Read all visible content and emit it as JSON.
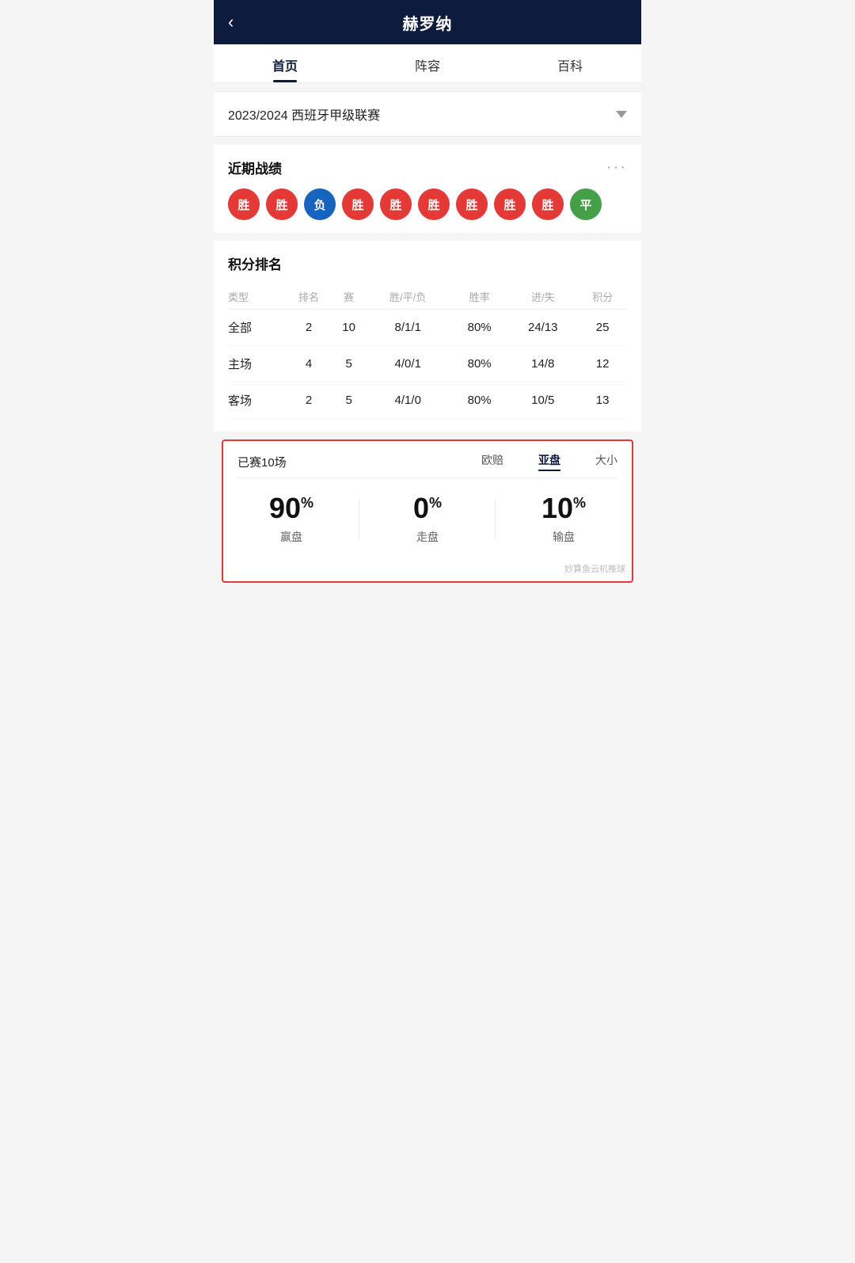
{
  "header": {
    "title": "赫罗纳",
    "back_icon": "‹"
  },
  "tabs": [
    {
      "label": "首页",
      "active": true
    },
    {
      "label": "阵容",
      "active": false
    },
    {
      "label": "百科",
      "active": false
    }
  ],
  "season": {
    "label": "2023/2024 西班牙甲级联赛"
  },
  "recent_results": {
    "title": "近期战绩",
    "more": "···",
    "results": [
      {
        "text": "胜",
        "type": "win"
      },
      {
        "text": "胜",
        "type": "win"
      },
      {
        "text": "负",
        "type": "loss"
      },
      {
        "text": "胜",
        "type": "win"
      },
      {
        "text": "胜",
        "type": "win"
      },
      {
        "text": "胜",
        "type": "win"
      },
      {
        "text": "胜",
        "type": "win"
      },
      {
        "text": "胜",
        "type": "win"
      },
      {
        "text": "胜",
        "type": "win"
      },
      {
        "text": "平",
        "type": "draw"
      }
    ]
  },
  "standings": {
    "title": "积分排名",
    "columns": [
      "类型",
      "排名",
      "赛",
      "胜/平/负",
      "胜率",
      "进/失",
      "积分"
    ],
    "rows": [
      {
        "type": "全部",
        "rank": "2",
        "matches": "10",
        "record": "8/1/1",
        "winrate": "80%",
        "goals": "24/13",
        "points": "25"
      },
      {
        "type": "主场",
        "rank": "4",
        "matches": "5",
        "record": "4/0/1",
        "winrate": "80%",
        "goals": "14/8",
        "points": "12"
      },
      {
        "type": "客场",
        "rank": "2",
        "matches": "5",
        "record": "4/1/0",
        "winrate": "80%",
        "goals": "10/5",
        "points": "13"
      }
    ]
  },
  "odds": {
    "played": "已赛10场",
    "types": [
      {
        "label": "欧赔",
        "active": false
      },
      {
        "label": "亚盘",
        "active": true
      },
      {
        "label": "大小",
        "active": false
      }
    ],
    "stats": [
      {
        "percent": "90",
        "label": "赢盘"
      },
      {
        "percent": "0",
        "label": "走盘"
      },
      {
        "percent": "10",
        "label": "输盘"
      }
    ],
    "watermark": "妙算鱼云机推球"
  }
}
